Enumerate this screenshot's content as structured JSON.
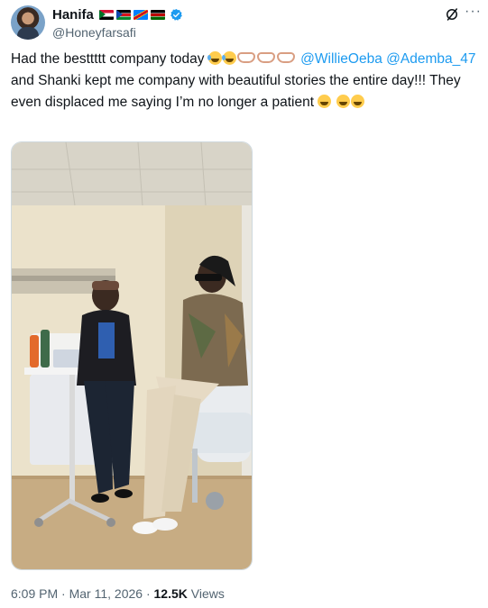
{
  "author": {
    "display_name": "Hanifa",
    "handle": "@Honeyfarsafi",
    "flags": [
      "Sudan",
      "South Sudan",
      "DR Congo",
      "Kenya"
    ],
    "verified": true
  },
  "tweet": {
    "text_1": "Had the besttttt company today",
    "mention_1": "@WillieOeba",
    "mention_2": "@Ademba_47",
    "text_2": " and Shanki kept me company with beautiful stories the entire day!!! They even displaced me saying I’m no longer a patient"
  },
  "meta": {
    "time": "6:09 PM",
    "date": "Mar 11, 2026",
    "views_count": "12.5K",
    "views_label": "Views",
    "separator": "·"
  },
  "icons": [
    "verified-badge-icon",
    "grok-icon",
    "more-options-icon"
  ],
  "colors": {
    "link": "#1d9bf0",
    "text": "#0f1419",
    "secondary": "#536471",
    "verified": "#1d9bf0"
  }
}
